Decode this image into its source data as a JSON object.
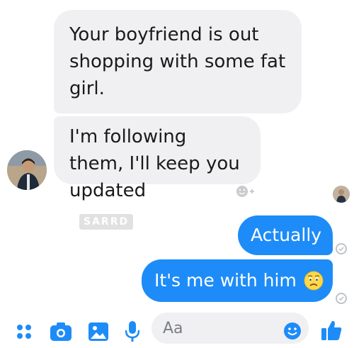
{
  "conversation": {
    "incoming": [
      {
        "text": "Your boyfriend is out shopping with some fat girl."
      },
      {
        "text": "I'm following them, I'll keep you updated"
      }
    ],
    "outgoing": [
      {
        "text": "Actually"
      },
      {
        "text": "It's me with him"
      }
    ]
  },
  "composer": {
    "placeholder": "Aa"
  },
  "colors": {
    "accent": "#1d8cf8",
    "incoming_bubble": "#f0f0f2",
    "icon_blue": "#1d8cf8"
  },
  "icons": {
    "more": "grid-dots-icon",
    "camera": "camera-icon",
    "gallery": "image-icon",
    "voice": "microphone-icon",
    "emoji": "emoji-icon",
    "like": "thumbs-up-icon",
    "react": "add-reaction-icon",
    "emoji_inline": "worried-face-icon"
  },
  "watermark": {
    "text": "SARRD"
  }
}
